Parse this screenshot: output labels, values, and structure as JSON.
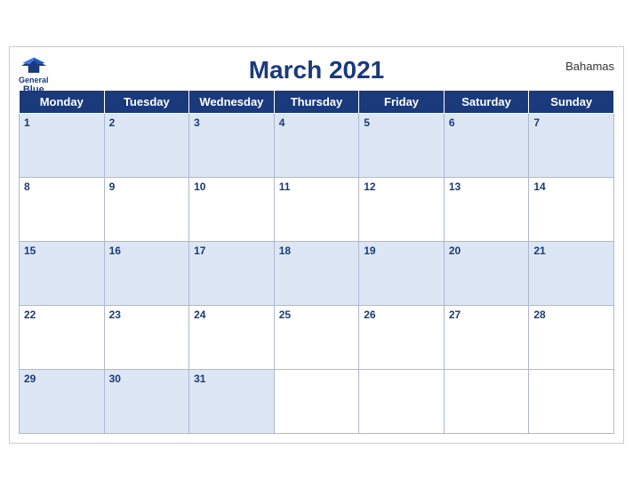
{
  "header": {
    "title": "March 2021",
    "country": "Bahamas",
    "logo_general": "General",
    "logo_blue": "Blue"
  },
  "weekdays": [
    "Monday",
    "Tuesday",
    "Wednesday",
    "Thursday",
    "Friday",
    "Saturday",
    "Sunday"
  ],
  "weeks": [
    [
      1,
      2,
      3,
      4,
      5,
      6,
      7
    ],
    [
      8,
      9,
      10,
      11,
      12,
      13,
      14
    ],
    [
      15,
      16,
      17,
      18,
      19,
      20,
      21
    ],
    [
      22,
      23,
      24,
      25,
      26,
      27,
      28
    ],
    [
      29,
      30,
      31,
      null,
      null,
      null,
      null
    ]
  ]
}
